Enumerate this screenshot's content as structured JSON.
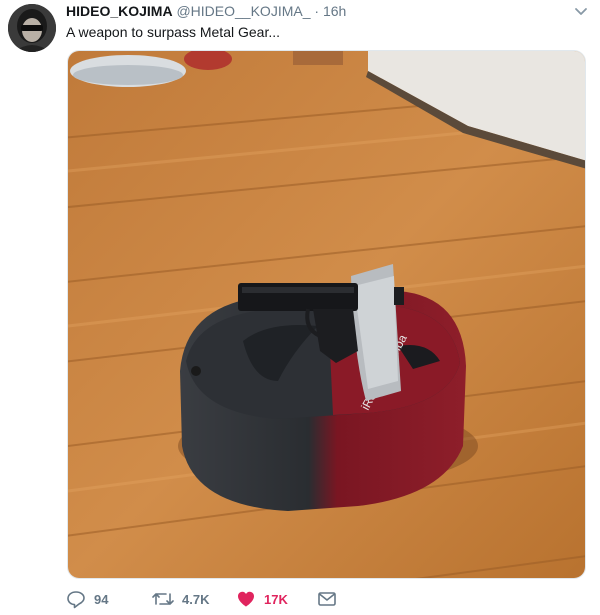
{
  "author": {
    "name": "HIDEO_KOJIMA",
    "handle": "@HIDEO__KOJIMA_",
    "separator": "·",
    "time": "16h"
  },
  "tweet": {
    "text": "A weapon to surpass Metal Gear..."
  },
  "media": {
    "kind": "photo",
    "content": "pistol taped to a robot vacuum on a wood floor",
    "robot_brand_text": "iRobot Roomba"
  },
  "actions": {
    "reply_count": "94",
    "retweet_count": "4.7K",
    "like_count": "17K"
  },
  "colors": {
    "secondary_text": "#657786",
    "like": "#e0245e",
    "border": "#e1e8ed"
  },
  "icons": [
    "caret-down-icon",
    "reply-icon",
    "retweet-icon",
    "heart-icon",
    "direct-message-icon"
  ]
}
